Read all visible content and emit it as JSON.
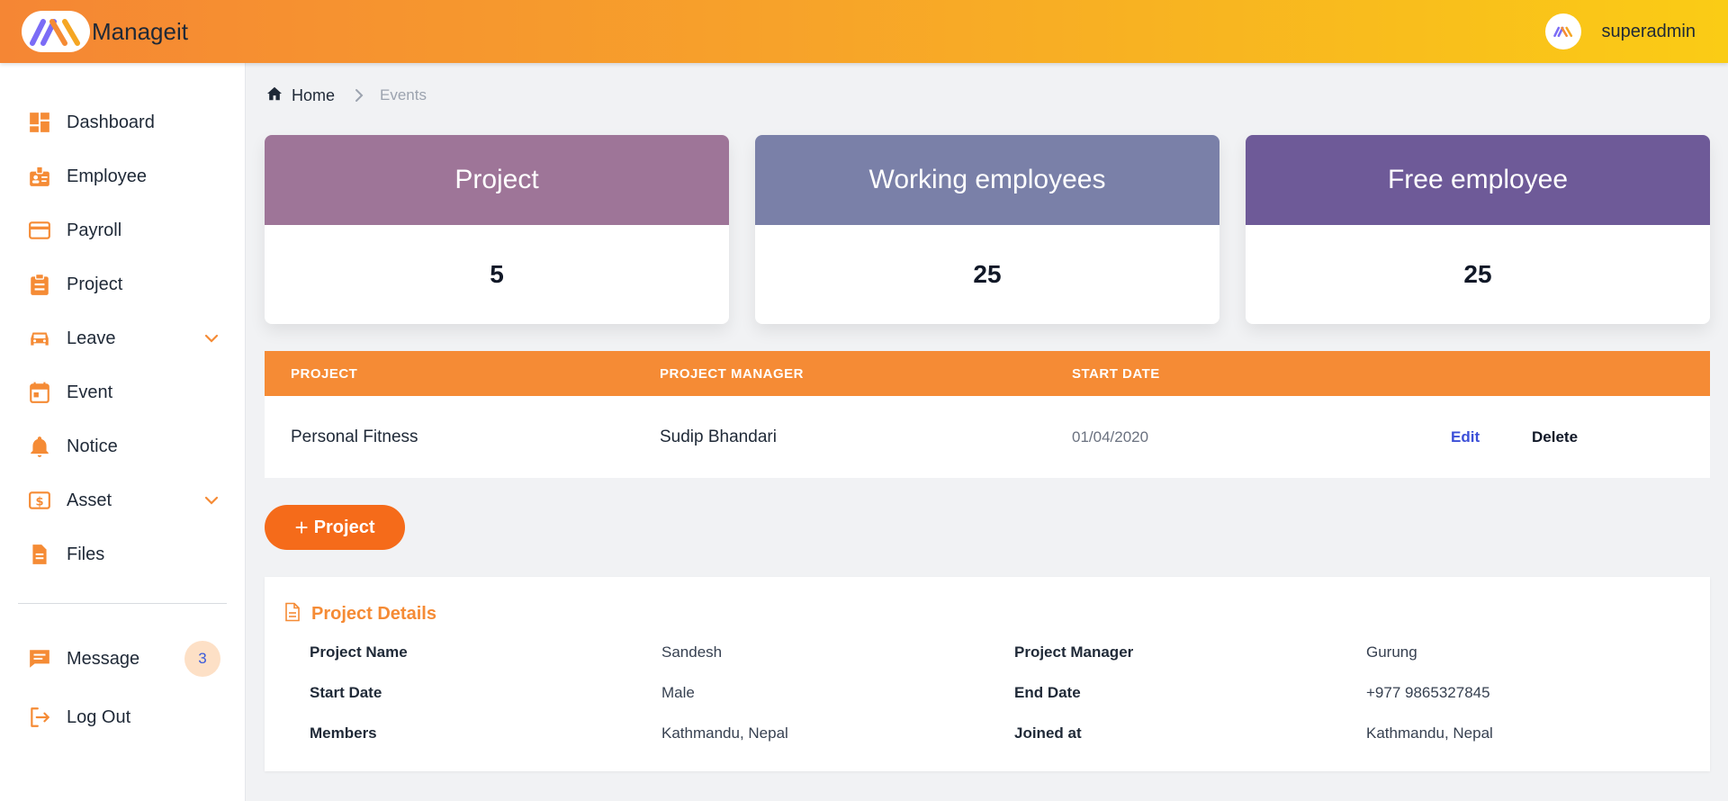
{
  "app": {
    "brand": "Manageit",
    "user": "superadmin"
  },
  "colors": {
    "accent": "#f58b35",
    "stat_project": "#9e7598",
    "stat_working": "#7a80a8",
    "stat_free": "#6e5a98"
  },
  "sidebar": {
    "items": [
      {
        "label": "Dashboard",
        "icon": "dashboard-icon"
      },
      {
        "label": "Employee",
        "icon": "id-badge-icon"
      },
      {
        "label": "Payroll",
        "icon": "credit-card-icon"
      },
      {
        "label": "Project",
        "icon": "clipboard-icon"
      },
      {
        "label": "Leave",
        "icon": "car-icon"
      },
      {
        "label": "Event",
        "icon": "calendar-icon"
      },
      {
        "label": "Notice",
        "icon": "bell-icon"
      },
      {
        "label": "Asset",
        "icon": "dollar-icon"
      },
      {
        "label": "Files",
        "icon": "file-icon"
      }
    ],
    "message": {
      "label": "Message",
      "count": "3"
    },
    "logout": {
      "label": "Log Out"
    }
  },
  "breadcrumb": {
    "home": "Home",
    "current": "Events"
  },
  "stats": [
    {
      "title": "Project",
      "value": "5"
    },
    {
      "title": "Working employees",
      "value": "25"
    },
    {
      "title": "Free employee",
      "value": "25"
    }
  ],
  "table": {
    "headers": [
      "PROJECT",
      "PROJECT MANAGER",
      "START DATE"
    ],
    "rows": [
      {
        "project": "Personal Fitness",
        "manager": "Sudip Bhandari",
        "start_date": "01/04/2020",
        "edit": "Edit",
        "delete": "Delete"
      }
    ]
  },
  "add_button": {
    "label": "Project"
  },
  "details": {
    "title": "Project Details",
    "fields": [
      {
        "label": "Project Name",
        "value": "Sandesh"
      },
      {
        "label": "Project Manager",
        "value": "Gurung"
      },
      {
        "label": "Start Date",
        "value": "Male"
      },
      {
        "label": "End Date",
        "value": "+977 9865327845"
      },
      {
        "label": "Members",
        "value": "Kathmandu, Nepal"
      },
      {
        "label": "Joined at",
        "value": "Kathmandu, Nepal"
      }
    ]
  }
}
